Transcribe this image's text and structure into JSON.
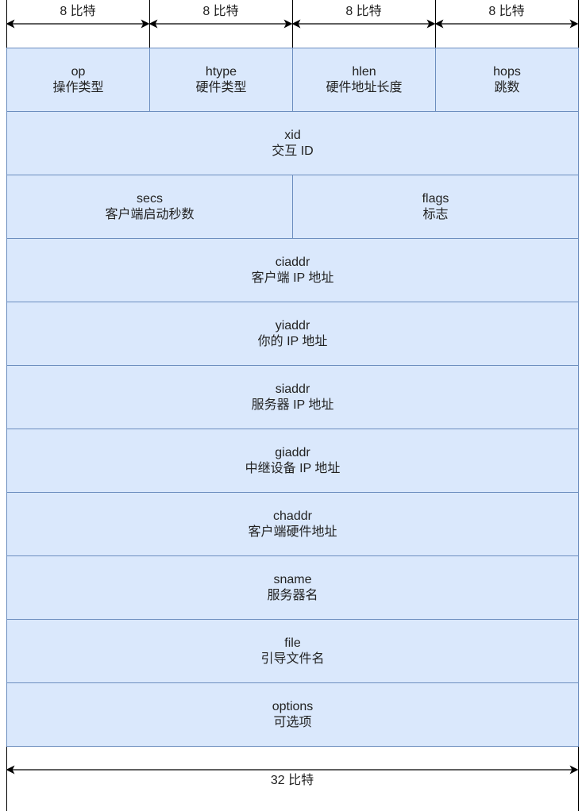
{
  "top_header": {
    "columns": [
      {
        "label": "8 比特"
      },
      {
        "label": "8 比特"
      },
      {
        "label": "8 比特"
      },
      {
        "label": "8 比特"
      }
    ]
  },
  "fields": [
    {
      "name": "op",
      "desc": "操作类型",
      "bits": 8
    },
    {
      "name": "htype",
      "desc": "硬件类型",
      "bits": 8
    },
    {
      "name": "hlen",
      "desc": "硬件地址长度",
      "bits": 8
    },
    {
      "name": "hops",
      "desc": "跳数",
      "bits": 8
    },
    {
      "name": "xid",
      "desc": "交互 ID",
      "bits": 32
    },
    {
      "name": "secs",
      "desc": "客户端启动秒数",
      "bits": 16
    },
    {
      "name": "flags",
      "desc": "标志",
      "bits": 16
    },
    {
      "name": "ciaddr",
      "desc": "客户端 IP 地址",
      "bits": 32
    },
    {
      "name": "yiaddr",
      "desc": "你的 IP 地址",
      "bits": 32
    },
    {
      "name": "siaddr",
      "desc": "服务器 IP 地址",
      "bits": 32
    },
    {
      "name": "giaddr",
      "desc": "中继设备 IP 地址",
      "bits": 32
    },
    {
      "name": "chaddr",
      "desc": "客户端硬件地址",
      "bits": 32
    },
    {
      "name": "sname",
      "desc": "服务器名",
      "bits": 32
    },
    {
      "name": "file",
      "desc": "引导文件名",
      "bits": 32
    },
    {
      "name": "options",
      "desc": "可选项",
      "bits": 32
    }
  ],
  "bottom_header": {
    "label": "32 比特"
  },
  "colors": {
    "cell_fill": "#dae8fc",
    "cell_stroke": "#6c8ebf",
    "line": "#000000"
  }
}
